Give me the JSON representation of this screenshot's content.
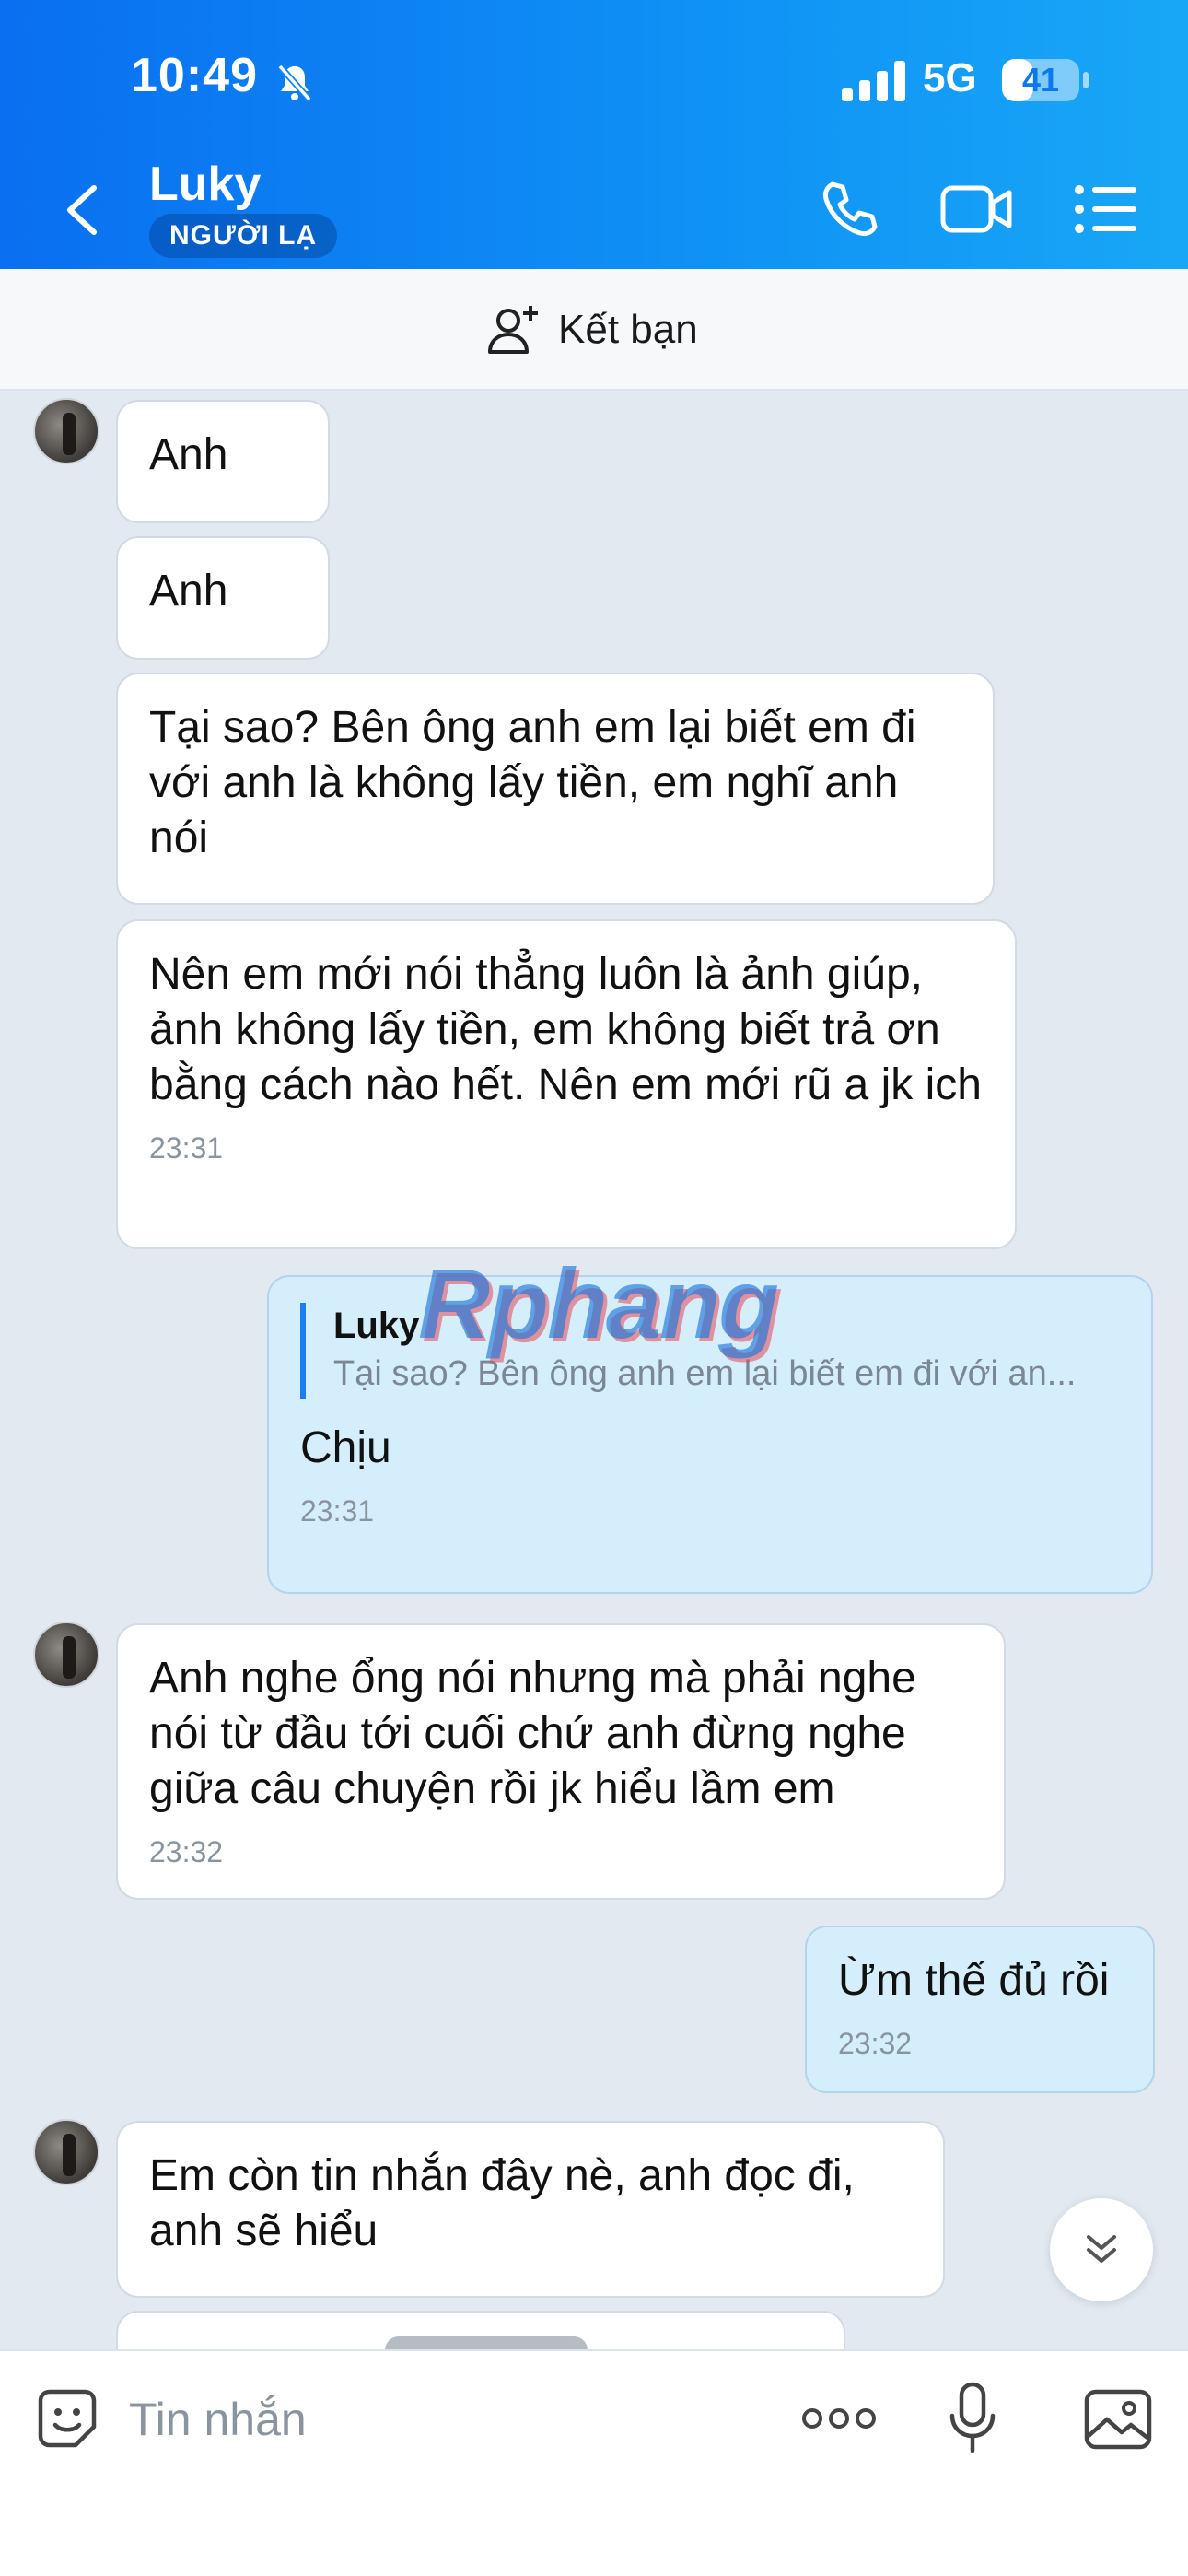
{
  "status_bar": {
    "time": "10:49",
    "network": "5G",
    "battery": "41",
    "battery_level": 0.41
  },
  "header": {
    "title": "Luky",
    "badge": "NGƯỜI LẠ"
  },
  "friend_bar": {
    "label": "Kết bạn"
  },
  "messages": [
    {
      "text": "Anh"
    },
    {
      "text": "Anh"
    },
    {
      "text": "Tại sao? Bên ông anh em lại biết em đi với anh là không lấy tiền, em nghĩ anh nói"
    },
    {
      "text": "Nên em mới nói thẳng luôn là ảnh giúp, ảnh không lấy tiền, em không biết trả ơn bằng cách nào hết. Nên em mới rũ a jk ich",
      "time": "23:31"
    },
    {
      "reply_author": "Luky",
      "reply_text": "Tại sao? Bên ông anh em lại biết em đi với an...",
      "text": "Chịu",
      "time": "23:31"
    },
    {
      "text": "Anh nghe ổng nói nhưng mà phải nghe nói từ đầu tới cuối chứ anh đừng nghe giữa câu chuyện rồi jk hiểu lầm em",
      "time": "23:32"
    },
    {
      "text": "Ừm thế đủ rồi",
      "time": "23:32"
    },
    {
      "text": "Em còn tin nhắn đây nè, anh đọc đi, anh sẽ hiểu"
    }
  ],
  "watermark": "Rphang",
  "input": {
    "placeholder": "Tin nhắn"
  },
  "colors": {
    "header_start": "#0a6ff0",
    "header_end": "#18a7f6",
    "chat_bg": "#e2e9f1",
    "my_bubble": "#d4eefc",
    "accent": "#1a7ef0"
  },
  "icons": [
    "bell-slash-icon",
    "signal-icon",
    "chevron-left-icon",
    "phone-icon",
    "video-camera-icon",
    "list-menu-icon",
    "add-user-icon",
    "double-chevron-down-icon",
    "sticker-icon",
    "more-dots-icon",
    "microphone-icon",
    "image-icon"
  ]
}
